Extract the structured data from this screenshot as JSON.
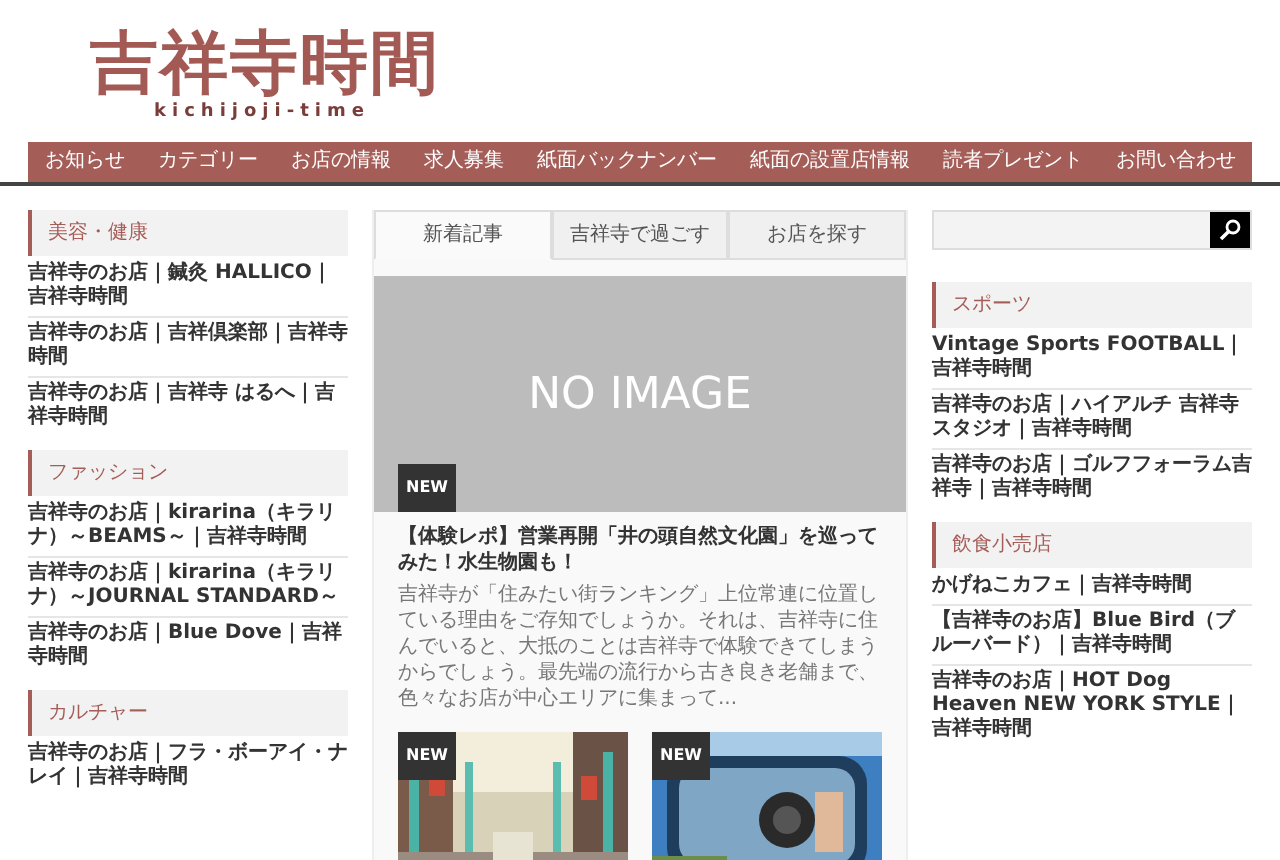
{
  "logo": {
    "title": "吉祥寺時間",
    "subtitle": "kichijoji-time"
  },
  "nav": [
    "お知らせ",
    "カテゴリー",
    "お店の情報",
    "求人募集",
    "紙面バックナンバー",
    "紙面の設置店情報",
    "読者プレゼント",
    "お問い合わせ"
  ],
  "left_sidebar": [
    {
      "heading": "美容・健康",
      "links": [
        "吉祥寺のお店｜鍼灸 HALLICO｜吉祥寺時間",
        "吉祥寺のお店｜吉祥倶楽部｜吉祥寺時間",
        "吉祥寺のお店｜吉祥寺 はるへ｜吉祥寺時間"
      ]
    },
    {
      "heading": "ファッション",
      "links": [
        "吉祥寺のお店｜kirarina（キラリナ）～BEAMS～｜吉祥寺時間",
        "吉祥寺のお店｜kirarina（キラリナ）～JOURNAL STANDARD～",
        "吉祥寺のお店｜Blue Dove｜吉祥寺時間"
      ]
    },
    {
      "heading": "カルチャー",
      "links": [
        "吉祥寺のお店｜フラ・ボーアイ・ナレイ｜吉祥寺時間"
      ]
    }
  ],
  "tabs": [
    {
      "label": "新着記事",
      "selected": true
    },
    {
      "label": "吉祥寺で過ごす",
      "selected": false
    },
    {
      "label": "お店を探す",
      "selected": false
    }
  ],
  "featured": {
    "image_text": "NO IMAGE",
    "badge": "NEW",
    "title": "【体験レポ】営業再開「井の頭自然文化園」を巡ってみた！水生物園も！",
    "excerpt": "吉祥寺が「住みたい街ランキング」上位常連に位置している理由をご存知でしょうか。それは、吉祥寺に住んでいると、大抵のことは吉祥寺で体験できてしまうからでしょう。最先端の流行から古き良き老舗まで、色々なお店が中心エリアに集まって..."
  },
  "thumbnails": [
    {
      "kind": "picture",
      "badge": "NEW"
    },
    {
      "kind": "picture",
      "badge": "NEW"
    }
  ],
  "right_sidebar": [
    {
      "heading": "スポーツ",
      "links": [
        "Vintage Sports FOOTBALL｜吉祥寺時間",
        "吉祥寺のお店｜ハイアルチ 吉祥寺スタジオ｜吉祥寺時間",
        "吉祥寺のお店｜ゴルフフォーラム吉祥寺｜吉祥寺時間"
      ]
    },
    {
      "heading": "飲食小売店",
      "links": [
        "かげねこカフェ｜吉祥寺時間",
        "【吉祥寺のお店】Blue Bird（ブルーバード）｜吉祥寺時間",
        "吉祥寺のお店｜HOT Dog Heaven NEW YORK STYLE｜吉祥寺時間"
      ]
    }
  ]
}
